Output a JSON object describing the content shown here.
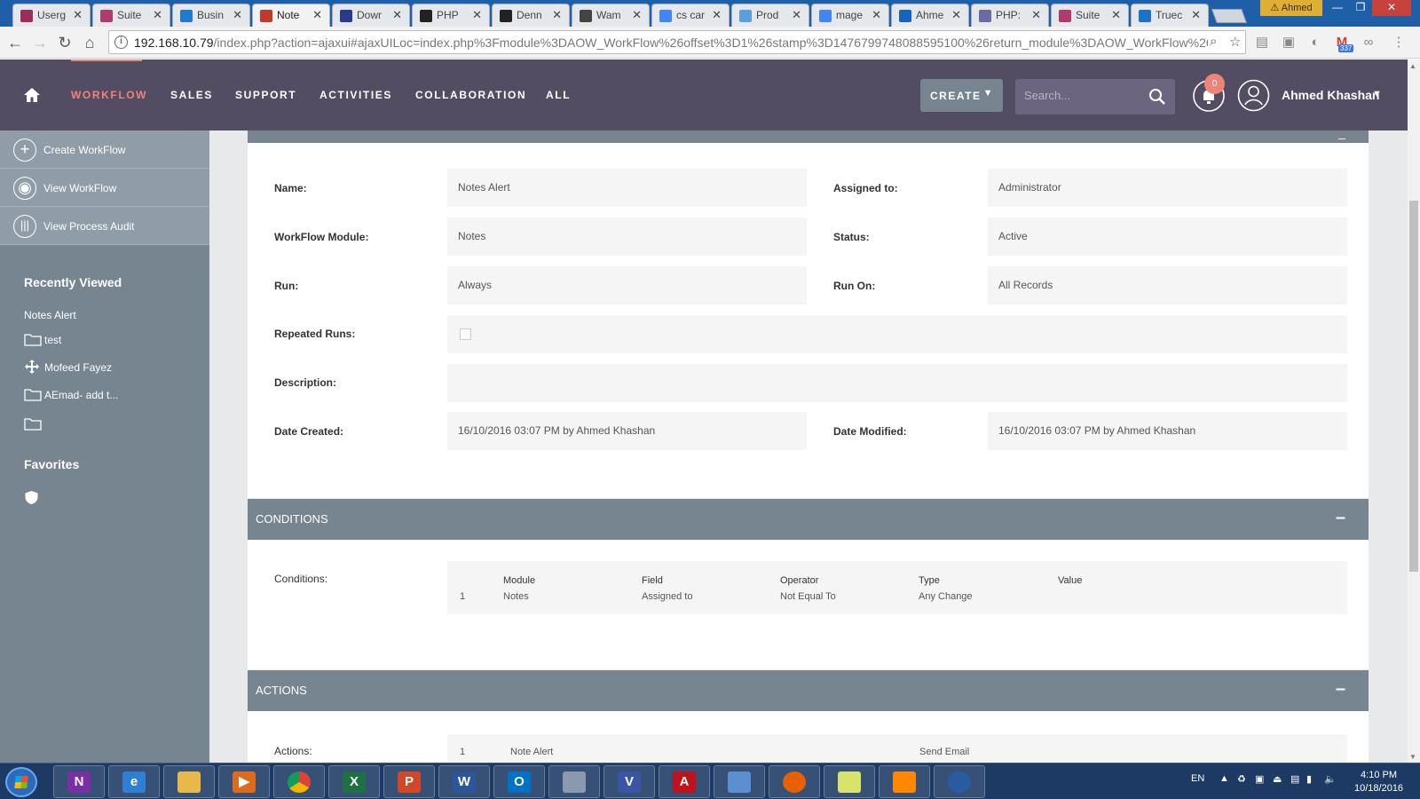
{
  "browser": {
    "tabs": [
      {
        "label": "Userg",
        "color": "#9c2c5a",
        "active": false
      },
      {
        "label": "Suite",
        "color": "#b13a6e",
        "active": false
      },
      {
        "label": "Busin",
        "color": "#1e7bd0",
        "active": false
      },
      {
        "label": "Note",
        "color": "#c0392b",
        "active": true
      },
      {
        "label": "Dowr",
        "color": "#2a3b8f",
        "active": false
      },
      {
        "label": "PHP",
        "color": "#222222",
        "active": false
      },
      {
        "label": "Denn",
        "color": "#222222",
        "active": false
      },
      {
        "label": "Wam",
        "color": "#444444",
        "active": false
      },
      {
        "label": "cs car",
        "color": "#4285f4",
        "active": false
      },
      {
        "label": "Prod",
        "color": "#5aa0e0",
        "active": false
      },
      {
        "label": "mage",
        "color": "#4285f4",
        "active": false
      },
      {
        "label": "Ahme",
        "color": "#1565c0",
        "active": false
      },
      {
        "label": "PHP:",
        "color": "#6a6aa5",
        "active": false
      },
      {
        "label": "Suite",
        "color": "#b13a6e",
        "active": false
      },
      {
        "label": "Truec",
        "color": "#1a73c8",
        "active": false
      }
    ],
    "profile": "Ahmed",
    "url_host": "192.168.10.79",
    "url_rest": "/index.php?action=ajaxui#ajaxUILoc=index.php%3Fmodule%3DAOW_WorkFlow%26offset%3D1%26stamp%3D1476799748088595100%26return_module%3DAOW_WorkFlow%26act",
    "gmail_count": "337"
  },
  "nav": {
    "items": [
      "WORKFLOW",
      "SALES",
      "SUPPORT",
      "ACTIVITIES",
      "COLLABORATION",
      "ALL"
    ],
    "create_label": "CREATE",
    "search_placeholder": "Search...",
    "notification_count": "0",
    "user_name": "Ahmed Khashan"
  },
  "sidebar": {
    "actions": [
      "Create WorkFlow",
      "View WorkFlow",
      "View Process Audit"
    ],
    "recently_viewed_title": "Recently Viewed",
    "recent": [
      {
        "label": "Notes Alert",
        "icon": "none"
      },
      {
        "label": "test",
        "icon": "folder-icon"
      },
      {
        "label": "Mofeed Fayez",
        "icon": "move-icon"
      },
      {
        "label": "AEmad- add t...",
        "icon": "folder-icon"
      },
      {
        "label": "",
        "icon": "folder-icon"
      }
    ],
    "favorites_title": "Favorites"
  },
  "detail": {
    "name_label": "Name:",
    "name": "Notes Alert",
    "assigned_label": "Assigned to:",
    "assigned": "Administrator",
    "module_label": "WorkFlow Module:",
    "module": "Notes",
    "status_label": "Status:",
    "status": "Active",
    "run_label": "Run:",
    "run": "Always",
    "run_on_label": "Run On:",
    "run_on": "All Records",
    "repeated_label": "Repeated Runs:",
    "description_label": "Description:",
    "description": "",
    "created_label": "Date Created:",
    "created": "16/10/2016 03:07 PM by Ahmed Khashan",
    "modified_label": "Date Modified:",
    "modified": "16/10/2016 03:07 PM by Ahmed Khashan"
  },
  "conditions": {
    "title": "CONDITIONS",
    "label": "Conditions:",
    "headers": [
      "Module",
      "Field",
      "Operator",
      "Type",
      "Value"
    ],
    "rows": [
      {
        "num": "1",
        "module": "Notes",
        "field": "Assigned to",
        "operator": "Not Equal To",
        "type": "Any Change",
        "value": ""
      }
    ]
  },
  "actions": {
    "title": "ACTIONS",
    "label": "Actions:",
    "rows": [
      {
        "num": "1",
        "name": "Note Alert",
        "action": "Send Email"
      }
    ]
  },
  "taskbar": {
    "apps": [
      {
        "name": "onenote",
        "glyph": "N",
        "color": "#7b2fa5"
      },
      {
        "name": "internet-explorer",
        "glyph": "e",
        "color": "#2f7fd4"
      },
      {
        "name": "file-explorer",
        "glyph": "",
        "color": "#e8b84a"
      },
      {
        "name": "media-player",
        "glyph": "▶",
        "color": "#e06a1c"
      },
      {
        "name": "chrome",
        "glyph": "",
        "color": "#dd4b39"
      },
      {
        "name": "excel",
        "glyph": "X",
        "color": "#1e7145"
      },
      {
        "name": "powerpoint",
        "glyph": "P",
        "color": "#d24726"
      },
      {
        "name": "word",
        "glyph": "W",
        "color": "#2b579a"
      },
      {
        "name": "outlook",
        "glyph": "O",
        "color": "#0072c6"
      },
      {
        "name": "calculator",
        "glyph": "",
        "color": "#8a9aac"
      },
      {
        "name": "visio",
        "glyph": "V",
        "color": "#3955a3"
      },
      {
        "name": "acrobat",
        "glyph": "A",
        "color": "#c1121b"
      },
      {
        "name": "remote-desktop",
        "glyph": "",
        "color": "#5a8fd0"
      },
      {
        "name": "firefox",
        "glyph": "",
        "color": "#e66000"
      },
      {
        "name": "sticky-notes",
        "glyph": "",
        "color": "#d9e36a"
      },
      {
        "name": "vlc",
        "glyph": "",
        "color": "#ff8800"
      },
      {
        "name": "security",
        "glyph": "",
        "color": "#2c5aa0"
      }
    ],
    "language": "EN",
    "time": "4:10 PM",
    "date": "10/18/2016"
  }
}
